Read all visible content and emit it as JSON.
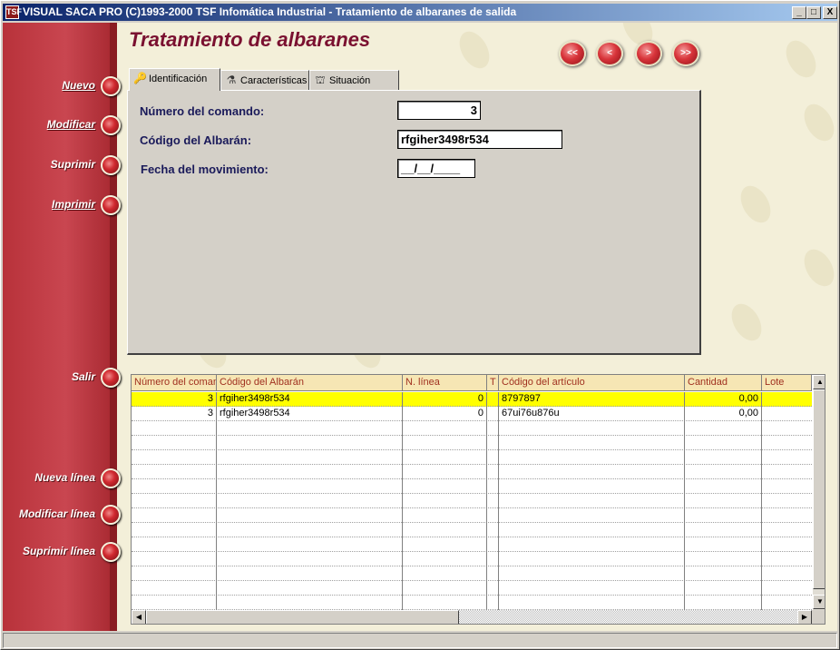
{
  "window": {
    "title": "VISUAL SACA PRO (C)1993-2000 TSF Infomática Industrial - Tratamiento de albaranes de salida",
    "app_icon": "TSF",
    "minimize": "_",
    "maximize": "□",
    "close": "X"
  },
  "page_title": "Tratamiento de albaranes",
  "sidebar": {
    "items": [
      {
        "label": "Nuevo"
      },
      {
        "label": "Modificar"
      },
      {
        "label": "Suprimir"
      },
      {
        "label": "Imprimir"
      },
      {
        "label": "Salir"
      },
      {
        "label": "Nueva línea"
      },
      {
        "label": "Modificar línea"
      },
      {
        "label": "Suprimir línea"
      }
    ]
  },
  "nav": {
    "first": "<<",
    "prev": "<",
    "next": ">",
    "last": ">>"
  },
  "tabs": [
    {
      "label": "Identificación",
      "icon": "key-icon",
      "glyph": "🔑"
    },
    {
      "label": "Características",
      "icon": "inspect-icon",
      "glyph": "⚗"
    },
    {
      "label": "Situación",
      "icon": "signpost-icon",
      "glyph": "⛫"
    }
  ],
  "form": {
    "numero_label": "Número del comando:",
    "numero_value": "3",
    "codigo_label": "Código del Albarán:",
    "codigo_value": "rfgiher3498r534",
    "fecha_label": "Fecha del movimiento:",
    "fecha_value": "__/__/____"
  },
  "grid": {
    "columns": [
      "Número del comando",
      "Código del Albarán",
      "N. línea",
      "T",
      "Código del artículo",
      "Cantidad",
      "Lote"
    ],
    "rows": [
      {
        "numero": "3",
        "codigo": "rfgiher3498r534",
        "linea": "0",
        "t": "",
        "articulo": "8797897",
        "cantidad": "0,00",
        "lote": ""
      },
      {
        "numero": "3",
        "codigo": "rfgiher3498r534",
        "linea": "0",
        "t": "",
        "articulo": "67ui76u876u",
        "cantidad": "0,00",
        "lote": ""
      }
    ]
  },
  "colors": {
    "sidebar": "#c94650",
    "title": "#7a1030",
    "selected_row": "#ffff00",
    "header_bg": "#f6e6b4"
  }
}
